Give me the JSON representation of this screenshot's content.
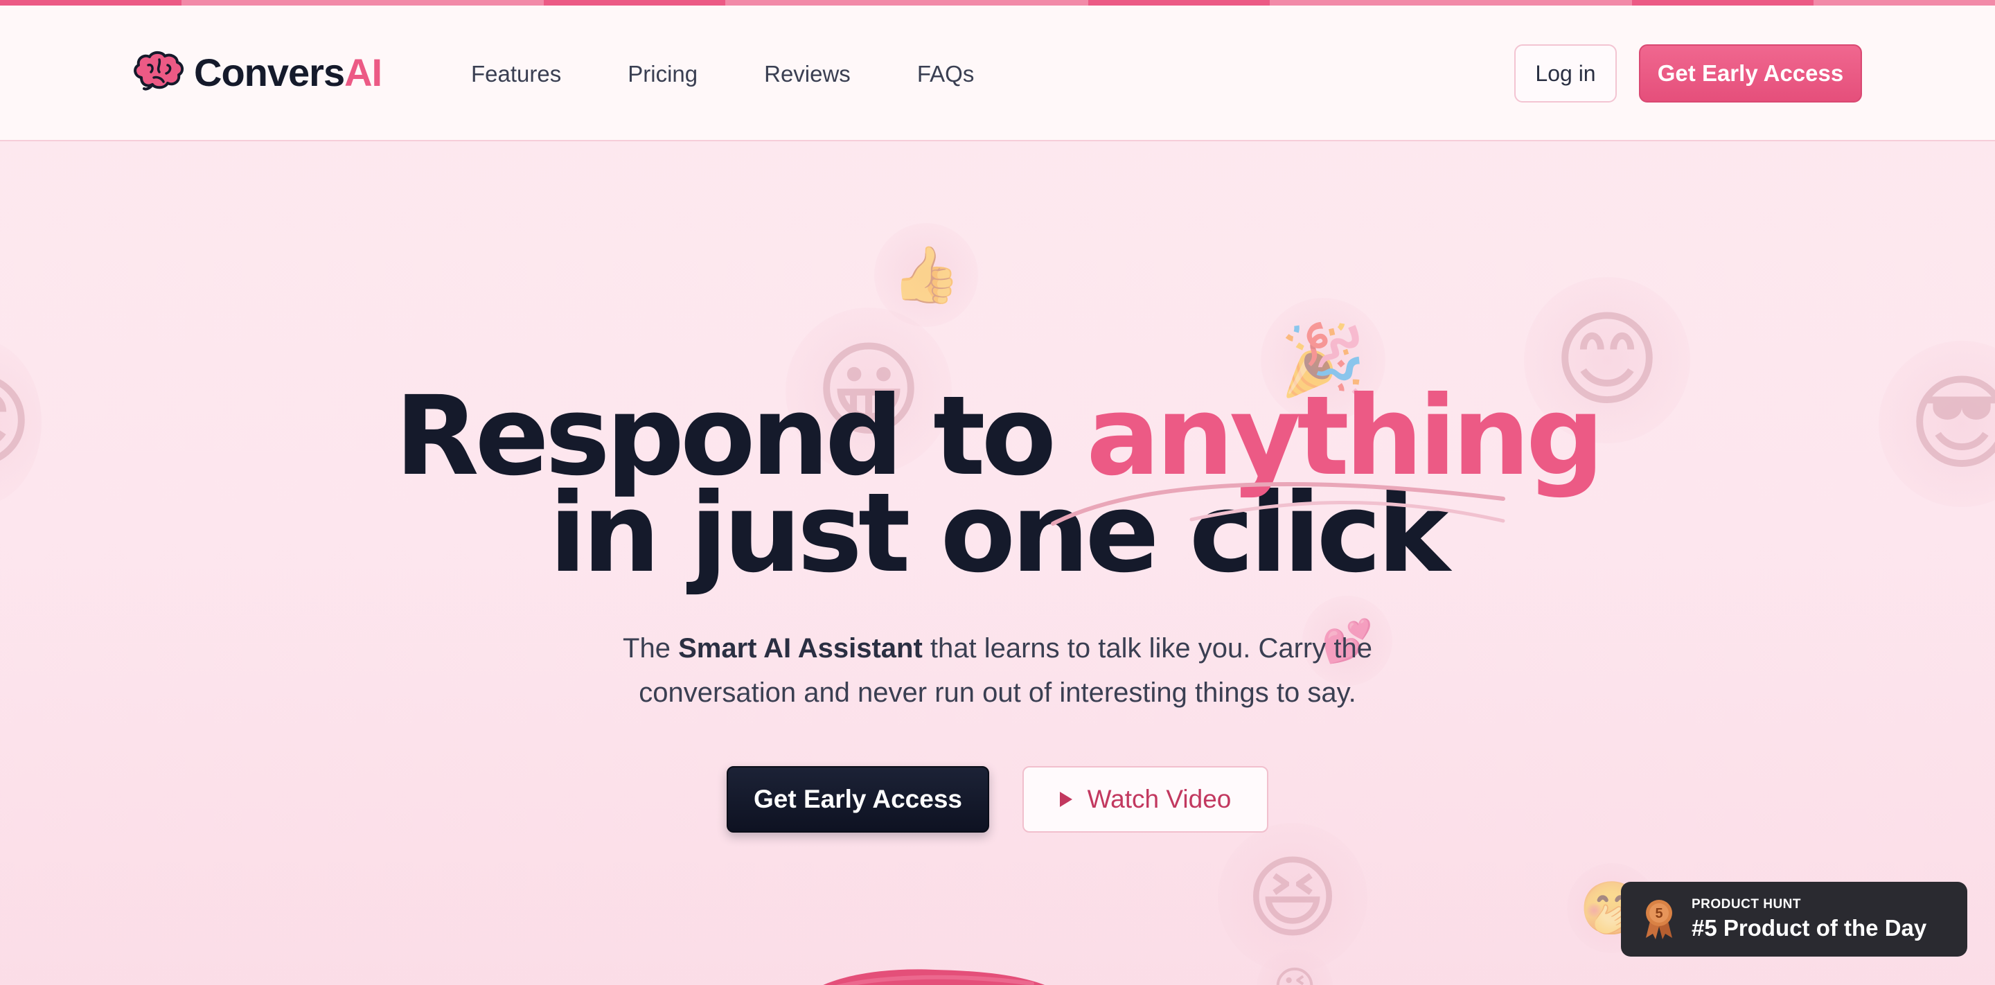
{
  "brand": {
    "name_part1": "Convers",
    "name_part2": "AI",
    "accent_color": "#ec5a85",
    "dark_color": "#151a2b"
  },
  "nav": {
    "items": [
      "Features",
      "Pricing",
      "Reviews",
      "FAQs"
    ]
  },
  "header": {
    "login_label": "Log in",
    "cta_label": "Get Early Access"
  },
  "hero": {
    "title_line1_before": "Respond to ",
    "title_line1_accent": "anything",
    "title_line2": "in just one click",
    "subtitle_before": "The ",
    "subtitle_bold": "Smart AI Assistant",
    "subtitle_line1_after": " that learns to talk like you. Carry the",
    "subtitle_line2": "conversation and never run out of interesting things to say.",
    "primary_cta": "Get Early Access",
    "secondary_cta": "Watch Video"
  },
  "product_hunt": {
    "kicker": "PRODUCT HUNT",
    "title": "#5 Product of the Day",
    "rank": "5"
  },
  "icons": {
    "logo": "brain-icon",
    "play": "play-icon",
    "medal": "medal-icon",
    "emoji": [
      "thumbs-up-icon",
      "grinning-face-icon",
      "party-popper-icon",
      "smiling-face-icon",
      "sunglasses-face-icon",
      "hearts-icon",
      "laughing-face-icon",
      "hand-over-mouth-icon",
      "kissing-face-icon"
    ]
  }
}
